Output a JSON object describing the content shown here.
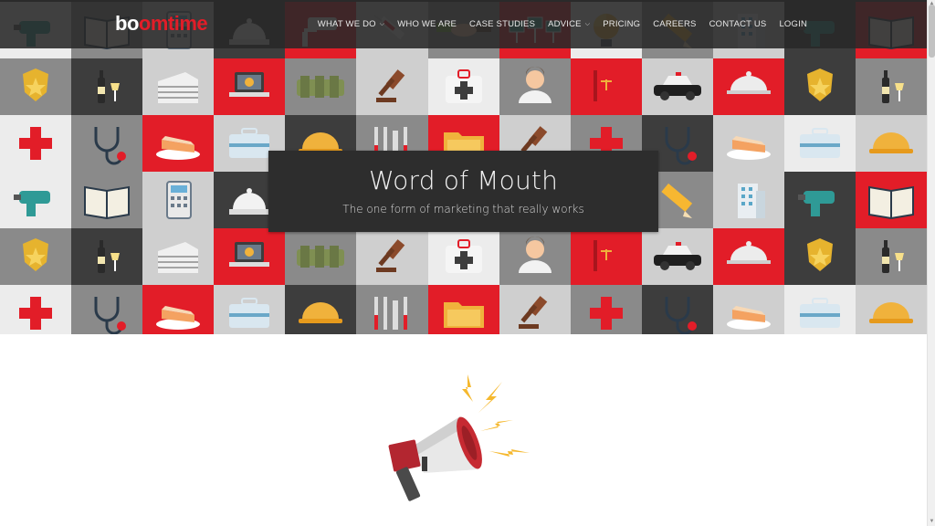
{
  "brand": {
    "logo_part1": "bo",
    "logo_part2": "om",
    "logo_part3": "time",
    "accent": "#e21d28"
  },
  "nav": {
    "items": [
      {
        "label": "WHAT WE DO",
        "has_dropdown": true
      },
      {
        "label": "WHO WE ARE",
        "has_dropdown": false
      },
      {
        "label": "CASE STUDIES",
        "has_dropdown": false
      },
      {
        "label": "ADVICE",
        "has_dropdown": true
      },
      {
        "label": "PRICING",
        "has_dropdown": false
      },
      {
        "label": "CAREERS",
        "has_dropdown": false
      },
      {
        "label": "CONTACT US",
        "has_dropdown": false
      },
      {
        "label": "LOGIN",
        "has_dropdown": false
      }
    ]
  },
  "hero": {
    "title": "Word of Mouth",
    "subtitle": "The one form of marketing that really works",
    "tiles": [
      [
        "drill-icon",
        "book-icon",
        "calculator-icon",
        "service-bell-icon",
        "security-camera-icon",
        "syringe-icon",
        "handshake-icon",
        "solar-panel-icon",
        "alarm-bell-icon",
        "pencil-icon",
        "office-building-icon"
      ],
      [
        "police-badge-icon",
        "wine-icon",
        "building-icon",
        "laptop-icon",
        "utility-belt-icon",
        "gavel-icon",
        "first-aid-kit-icon",
        "person-icon",
        "law-book-icon",
        "police-car-icon",
        "cloche-icon"
      ],
      [
        "red-cross-icon",
        "stethoscope-icon",
        "cake-icon",
        "toolbox-icon",
        "hard-hat-icon",
        "tools-icon",
        "folder-icon",
        "gavel-icon"
      ]
    ]
  },
  "illustration": {
    "name": "megaphone-icon"
  }
}
